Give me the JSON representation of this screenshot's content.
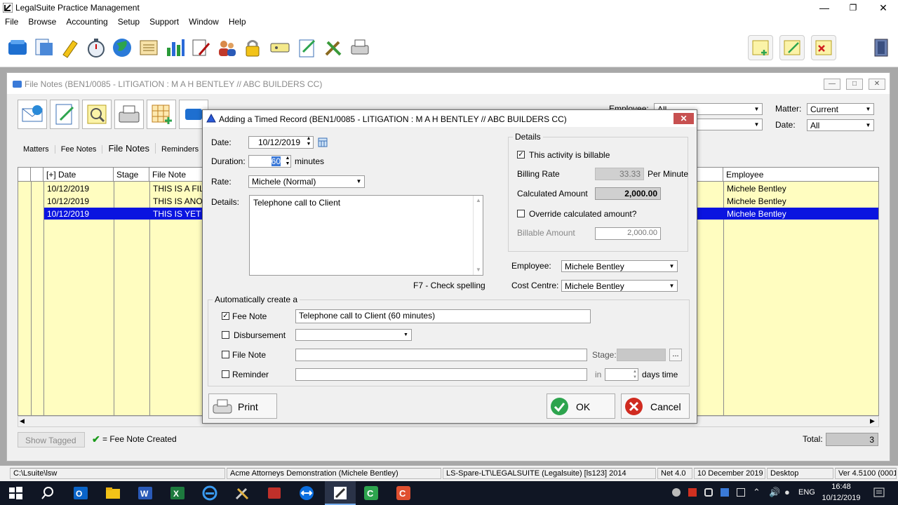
{
  "app": {
    "title": "LegalSuite Practice Management",
    "window_controls": [
      "minimize-icon",
      "restore-icon",
      "close-icon"
    ]
  },
  "menu": [
    "File",
    "Browse",
    "Accounting",
    "Setup",
    "Support",
    "Window",
    "Help"
  ],
  "file_notes_window": {
    "title": "File Notes (BEN1/0085 - LITIGATION : M A H BENTLEY // ABC BUILDERS CC)",
    "tabs": [
      "Matters",
      "Fee Notes",
      "File Notes",
      "Reminders"
    ],
    "active_tab": "File Notes",
    "filters": {
      "employee_label": "Employee:",
      "employee_value": "All",
      "matter_label": "Matter:",
      "matter_value": "Current",
      "date_label": "Date:",
      "date_value": "All"
    },
    "grid": {
      "columns": [
        "[+] Date",
        "Stage",
        "File Note",
        "Employee"
      ],
      "rows": [
        {
          "date": "10/12/2019",
          "stage": "",
          "note": "THIS IS A FILE",
          "employee": "Michele Bentley",
          "selected": false
        },
        {
          "date": "10/12/2019",
          "stage": "",
          "note": "THIS IS ANOT",
          "employee": "Michele Bentley",
          "selected": false
        },
        {
          "date": "10/12/2019",
          "stage": "",
          "note": "THIS IS YET A",
          "employee": "Michele Bentley",
          "selected": true
        }
      ]
    },
    "footer": {
      "show_tagged": "Show Tagged",
      "legend": "= Fee Note Created",
      "total_label": "Total:",
      "total_value": "3"
    }
  },
  "dialog": {
    "title": "Adding a Timed Record (BEN1/0085 - LITIGATION : M A H BENTLEY // ABC BUILDERS CC)",
    "date_label": "Date:",
    "date_value": "10/12/2019",
    "duration_label": "Duration:",
    "duration_value": "60",
    "duration_unit": "minutes",
    "rate_label": "Rate:",
    "rate_value": "Michele (Normal)",
    "details_label": "Details:",
    "details_value": "Telephone call to Client",
    "spell_hint": "F7 - Check spelling",
    "details_group": {
      "title": "Details",
      "billable_label": "This activity is billable",
      "billable_checked": true,
      "billing_rate_label": "Billing Rate",
      "billing_rate_value": "33.33",
      "per_minute": "Per Minute",
      "calculated_label": "Calculated Amount",
      "calculated_value": "2,000.00",
      "override_label": "Override calculated amount?",
      "override_checked": false,
      "billable_amount_label": "Billable Amount",
      "billable_amount_value": "2,000.00"
    },
    "employee_label": "Employee:",
    "employee_value": "Michele Bentley",
    "cost_centre_label": "Cost Centre:",
    "cost_centre_value": "Michele Bentley",
    "auto_group": {
      "title": "Automatically create a",
      "fee_note_label": "Fee Note",
      "fee_note_checked": true,
      "fee_note_value": "Telephone call to Client  (60 minutes)",
      "disbursement_label": "Disbursement",
      "disbursement_checked": false,
      "file_note_label": "File Note",
      "file_note_checked": false,
      "stage_label": "Stage:",
      "stage_button": "...",
      "reminder_label": "Reminder",
      "reminder_checked": false,
      "in_label": "in",
      "days_label": "days time"
    },
    "print_label": "Print",
    "ok_label": "OK",
    "cancel_label": "Cancel"
  },
  "statusbar": [
    "C:\\Lsuite\\lsw",
    "Acme Attorneys Demonstration (Michele Bentley)",
    "LS-Spare-LT\\LEGALSUITE (Legalsuite) [ls123] 2014",
    "Net 4.0",
    "10 December 2019",
    "Desktop",
    "Ver 4.5100 (0001)"
  ],
  "taskbar": {
    "language": "ENG",
    "time": "16:48",
    "date": "10/12/2019"
  }
}
